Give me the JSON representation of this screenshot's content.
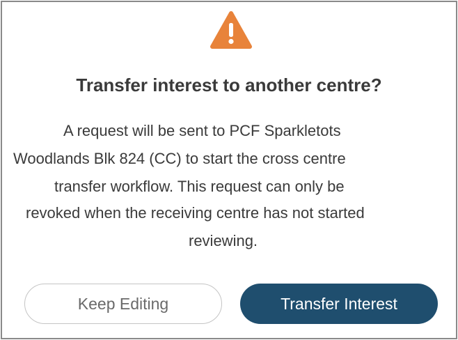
{
  "dialog": {
    "icon": "warning-triangle-icon",
    "accent_color": "#e8833a",
    "title": "Transfer interest to another centre?",
    "message_lines": [
      "A request will be sent to PCF Sparkletots",
      "Woodlands Blk 824 (CC) to start the cross centre",
      "transfer workflow. This request can only be",
      "revoked when the receiving centre has not started",
      "reviewing."
    ],
    "secondary_button": "Keep Editing",
    "primary_button": "Transfer Interest",
    "primary_color": "#1f4e6e"
  }
}
